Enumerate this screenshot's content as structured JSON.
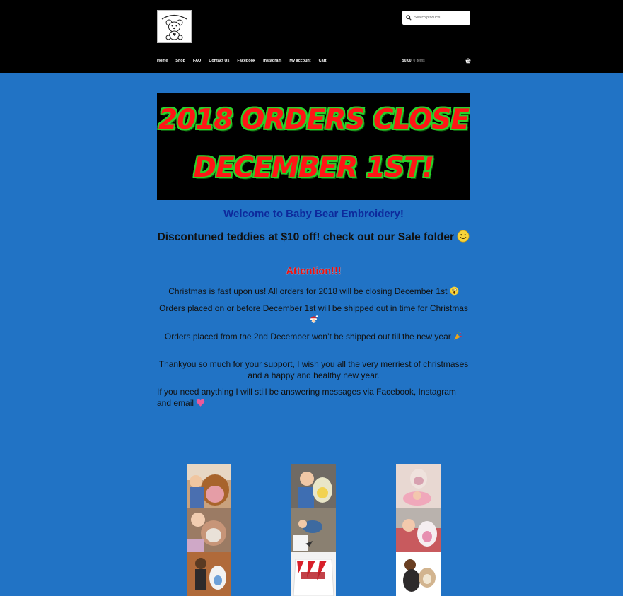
{
  "header": {
    "logo_text": "Baby Bear Embroidery",
    "search_placeholder": "Search products…",
    "nav": [
      "Home",
      "Shop",
      "FAQ",
      "Contact Us",
      "Facebook",
      "Instagram",
      "My account",
      "Cart"
    ],
    "cart_amount": "$0.00",
    "cart_count": "0 items"
  },
  "banner": {
    "line1": "2018 ORDERS CLOSE",
    "line2": "DECEMBER 1ST!",
    "text_color": "#ff1616",
    "outline_color": "#2ad12a"
  },
  "content": {
    "welcome": "Welcome to Baby Bear Embroidery!",
    "discontinued": "Discontuned teddies at $10 off! check out our Sale folder",
    "attention": "Attention!!!",
    "p1": "Christmas is fast upon us! All orders for 2018 will be closing December 1st",
    "p2": "Orders placed on or before December 1st will be shipped out in time for Christmas",
    "p3": "Orders placed from the 2nd December won’t be shipped out till the new year",
    "p4": "Thankyou so much for your support, I wish you all the very merriest of christmases and a happy and healthy new year.",
    "p5": "If you need anything I will still be answering messages via Facebook, Instagram and email"
  },
  "emojis": [
    "smile-emoji",
    "scream-emoji",
    "santa-emoji",
    "party-popper-emoji",
    "two-hearts-emoji"
  ],
  "colors": {
    "page_bg": "#2173c5",
    "header_bg": "#000000",
    "welcome_text": "#0d2a9c",
    "attention_text": "#e81313"
  }
}
